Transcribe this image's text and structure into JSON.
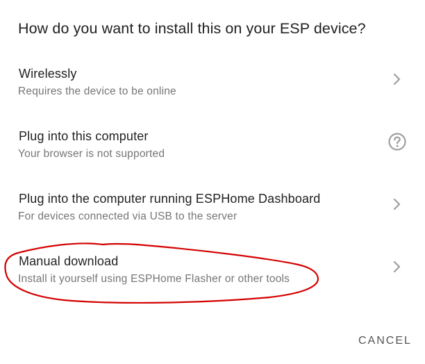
{
  "dialog": {
    "title": "How do you want to install this on your ESP device?",
    "options": [
      {
        "label": "Wirelessly",
        "description": "Requires the device to be online",
        "trailing_icon": "chevron-right-icon"
      },
      {
        "label": "Plug into this computer",
        "description": "Your browser is not supported",
        "trailing_icon": "help-circle-icon"
      },
      {
        "label": "Plug into the computer running ESPHome Dashboard",
        "description": "For devices connected via USB to the server",
        "trailing_icon": "chevron-right-icon"
      },
      {
        "label": "Manual download",
        "description": "Install it yourself using ESPHome Flasher or other tools",
        "trailing_icon": "chevron-right-icon"
      }
    ],
    "cancel_label": "CANCEL"
  },
  "colors": {
    "primary_text": "#212121",
    "secondary_text": "#757575",
    "icon": "#9e9e9e",
    "annotation_stroke": "#d40000"
  }
}
